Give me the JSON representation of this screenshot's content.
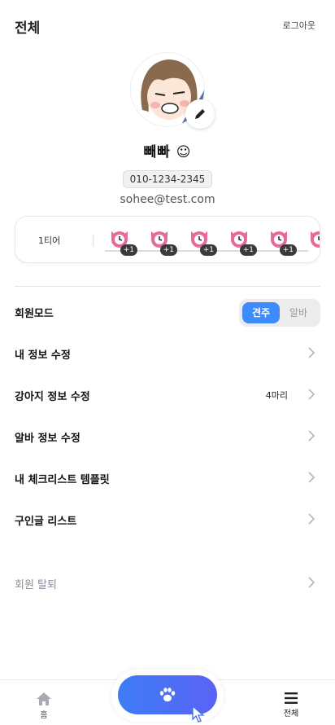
{
  "header": {
    "title": "전체",
    "logout_label": "로그아웃"
  },
  "profile": {
    "nickname": "빼빠 ☺",
    "phone": "010-1234-2345",
    "email": "sohee@test.com"
  },
  "tier": {
    "label": "1티어",
    "badges": [
      "+1",
      "+1",
      "+1",
      "+1",
      "+1",
      "+"
    ]
  },
  "menu": {
    "mode": {
      "label": "회원모드",
      "active": "견주",
      "inactive": "알바"
    },
    "items": [
      {
        "label": "내 정보 수정",
        "extra": ""
      },
      {
        "label": "강아지 정보 수정",
        "extra": "4마리"
      },
      {
        "label": "알바 정보 수정",
        "extra": ""
      },
      {
        "label": "내 체크리스트 템플릿",
        "extra": ""
      },
      {
        "label": "구인글 리스트",
        "extra": ""
      }
    ],
    "withdraw_label": "회원 탈퇴"
  },
  "bottom_nav": {
    "home_label": "홈",
    "all_label": "전체"
  },
  "colors": {
    "accent": "#3d8bfd",
    "fab_start": "#3d7cf5",
    "fab_end": "#5b63f4"
  }
}
